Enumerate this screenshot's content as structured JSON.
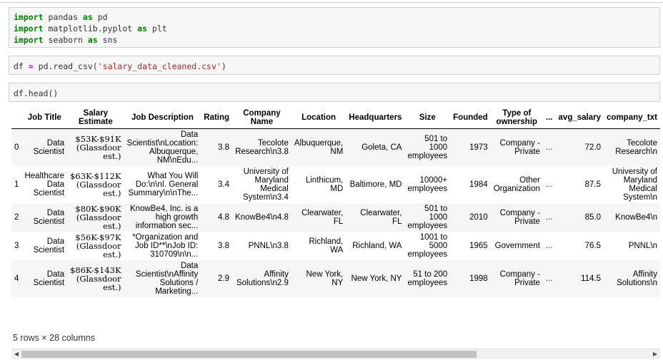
{
  "cells": [
    {
      "lines": [
        [
          {
            "t": "import",
            "c": "kw"
          },
          {
            "t": " pandas "
          },
          {
            "t": "as",
            "c": "kw"
          },
          {
            "t": " pd"
          }
        ],
        [
          {
            "t": "import",
            "c": "kw"
          },
          {
            "t": " matplotlib.pyplot "
          },
          {
            "t": "as",
            "c": "kw"
          },
          {
            "t": " plt"
          }
        ],
        [
          {
            "t": "import",
            "c": "kw"
          },
          {
            "t": " seaborn "
          },
          {
            "t": "as",
            "c": "kw"
          },
          {
            "t": " sns"
          }
        ]
      ]
    },
    {
      "lines": [
        [
          {
            "t": "df "
          },
          {
            "t": "=",
            "c": "op"
          },
          {
            "t": " pd.read_csv("
          },
          {
            "t": "'salary_data_cleaned.csv'",
            "c": "str"
          },
          {
            "t": ")"
          }
        ]
      ]
    },
    {
      "lines": [
        [
          {
            "t": "df.head()"
          }
        ]
      ]
    }
  ],
  "table": {
    "headers": [
      "",
      "Job Title",
      "Salary Estimate",
      "Job Description",
      "Rating",
      "Company Name",
      "Location",
      "Headquarters",
      "Size",
      "Founded",
      "Type of ownership",
      "...",
      "avg_salary",
      "company_txt"
    ],
    "rows": [
      [
        "0",
        "Data Scientist",
        "$53K-$91K (Glassdoor est.)",
        "Data Scientist\\nLocation: Albuquerque, NM\\nEdu...",
        "3.8",
        "Tecolote Research\\n3.8",
        "Albuquerque, NM",
        "Goleta, CA",
        "501 to 1000 employees",
        "1973",
        "Company - Private",
        "...",
        "72.0",
        "Tecolote Research\\n"
      ],
      [
        "1",
        "Healthcare Data Scientist",
        "$63K-$112K (Glassdoor est.)",
        "What You Will Do:\\n\\nI. General Summary\\n\\nThe...",
        "3.4",
        "University of Maryland Medical System\\n3.4",
        "Linthicum, MD",
        "Baltimore, MD",
        "10000+ employees",
        "1984",
        "Other Organization",
        "...",
        "87.5",
        "University of Maryland Medical System\\n"
      ],
      [
        "2",
        "Data Scientist",
        "$80K-$90K (Glassdoor est.)",
        "KnowBe4, Inc. is a high growth information sec...",
        "4.8",
        "KnowBe4\\n4.8",
        "Clearwater, FL",
        "Clearwater, FL",
        "501 to 1000 employees",
        "2010",
        "Company - Private",
        "...",
        "85.0",
        "KnowBe4\\n"
      ],
      [
        "3",
        "Data Scientist",
        "$56K-$97K (Glassdoor est.)",
        "*Organization and Job ID**\\nJob ID: 310709\\n\\n...",
        "3.8",
        "PNNL\\n3.8",
        "Richland, WA",
        "Richland, WA",
        "1001 to 5000 employees",
        "1965",
        "Government",
        "...",
        "76.5",
        "PNNL\\n"
      ],
      [
        "4",
        "Data Scientist",
        "$86K-$143K (Glassdoor est.)",
        "Data Scientist\\nAffinity Solutions / Marketing...",
        "2.9",
        "Affinity Solutions\\n2.9",
        "New York, NY",
        "New York, NY",
        "51 to 200 employees",
        "1998",
        "Company - Private",
        "...",
        "114.5",
        "Affinity Solutions\\n"
      ]
    ]
  },
  "shape_text": "5 rows × 28 columns",
  "scroll": {
    "left_arrow": "◀",
    "right_arrow": "▶"
  }
}
